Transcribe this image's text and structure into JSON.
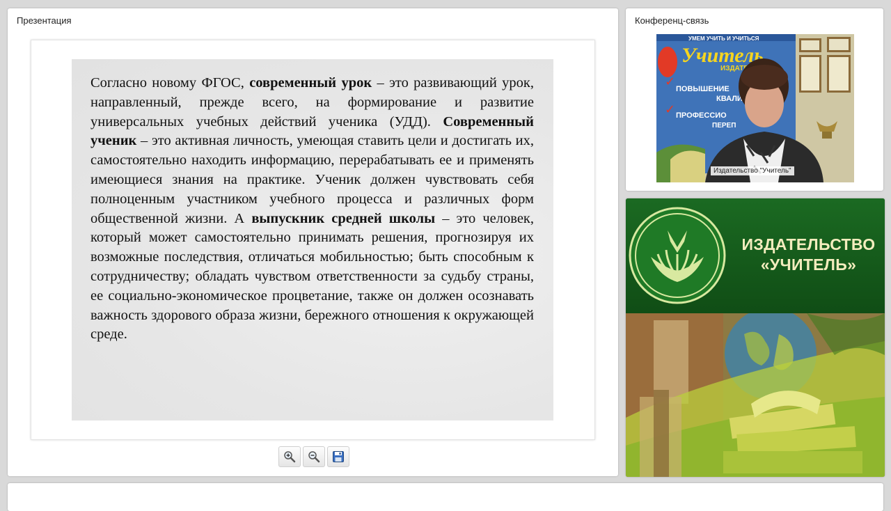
{
  "presentation": {
    "title": "Презентация",
    "slide": {
      "segments": [
        {
          "text": "Согласно новому ФГОС, ",
          "bold": false
        },
        {
          "text": "современный урок",
          "bold": true
        },
        {
          "text": " – это развивающий урок, направленный, прежде всего, на формирование и развитие универсальных учебных действий ученика (УДД). ",
          "bold": false
        },
        {
          "text": "Современный ученик",
          "bold": true
        },
        {
          "text": " – это активная личность, умеющая ставить цели и достигать их, самостоятельно находить информацию, перерабатывать ее и применять имеющиеся знания на практике. Ученик должен чувствовать себя полноценным участником учебного процесса и различных форм общественной жизни. А ",
          "bold": false
        },
        {
          "text": "выпускник средней школы",
          "bold": true
        },
        {
          "text": " – это человек, который может самостоятельно принимать решения, прогнозируя их возможные последствия, отличаться мобильностью; быть способным к сотрудничеству; обладать чувством ответственности за судьбу страны, ее социально-экономическое процветание, также он должен осознавать важность здорового образа жизни, бережного отношения к окружающей среде.",
          "bold": false
        }
      ]
    },
    "toolbar": [
      {
        "name": "zoom-in-button",
        "icon": "zoom-in-icon"
      },
      {
        "name": "zoom-out-button",
        "icon": "zoom-out-icon"
      },
      {
        "name": "save-button",
        "icon": "floppy-disk-icon"
      }
    ]
  },
  "conference": {
    "title": "Конференц-связь",
    "video": {
      "participant_label": "Издательство \"Учитель\"",
      "backdrop_text": {
        "top_line": "УМЕМ УЧИТЬ И УЧИТЬСЯ",
        "brand": "Учитель",
        "sub": "ИЗДАТЕ",
        "item1": "ПОВЫШЕНИЕ",
        "item1b": "КВАЛИФИ",
        "item2": "ПРОФЕССИО",
        "item2b": "ПЕРЕП"
      }
    }
  },
  "banner": {
    "line1": "ИЗДАТЕЛЬСТВО",
    "line2": "«УЧИТЕЛЬ»"
  },
  "colors": {
    "banner_green": "#14581a",
    "banner_text": "#f3edbe",
    "video_backdrop": "#3d6aa8"
  }
}
